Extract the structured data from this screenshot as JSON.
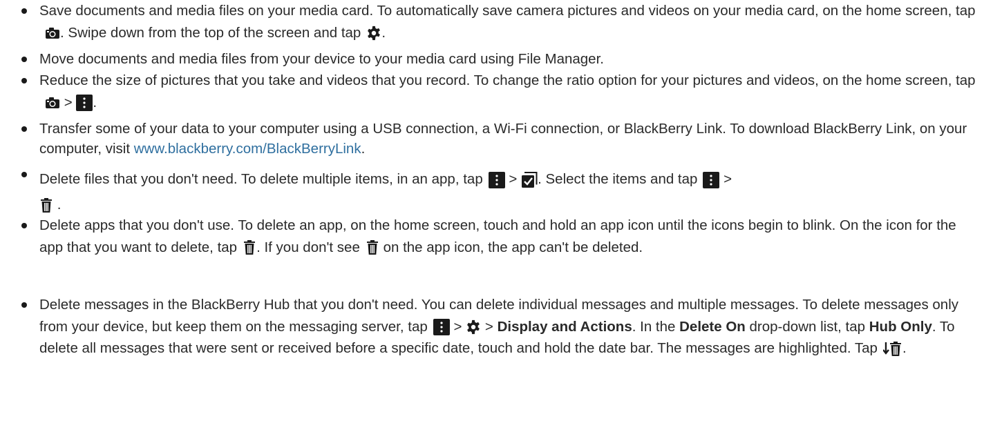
{
  "bullets": [
    {
      "p1": "Save documents and media files on your media card. To automatically save camera pictures and videos on your media card, on the home screen, tap",
      "p2": ". Swipe down from the top of the screen and tap",
      "p3": "."
    },
    {
      "p1": "Move documents and media files from your device to your media card using File Manager."
    },
    {
      "p1": "Reduce the size of pictures that you take and videos that you record. To change the ratio option for your pictures and videos, on the home screen, tap",
      "p2": ">",
      "p3": "."
    },
    {
      "p1": "Transfer some of your data to your computer using a USB connection, a Wi-Fi connection, or BlackBerry Link. To download BlackBerry Link, on your computer, visit",
      "link": "www.blackberry.com/BlackBerryLink",
      "p2": "."
    },
    {
      "p1": "Delete files that you don't need. To delete multiple items, in an app, tap",
      "p2": ">",
      "p3": ". Select the items and tap",
      "p4": ">",
      "p5": "."
    },
    {
      "p1": "Delete apps that you don't use. To delete an app, on the home screen, touch and hold an app icon until the icons begin to blink. On the icon for the app that you want to delete, tap",
      "p2": ". If you don't see",
      "p3": "on the app icon, the app can't be deleted."
    },
    {
      "p1": "Delete messages in the BlackBerry Hub that you don't need. You can delete individual messages and multiple messages. To delete messages only from your device, but keep them on the messaging server, tap",
      "p2": ">",
      "p3": ">",
      "b1": "Display and Actions",
      "p4": ". In the",
      "b2": "Delete On",
      "p5": "drop-down list, tap",
      "b3": "Hub Only",
      "p6": ". To delete all messages that were sent or received before a specific date, touch and hold the date bar. The messages are highlighted. Tap",
      "p7": "."
    }
  ],
  "icons": {
    "camera": "camera-icon",
    "settings": "gear-icon",
    "overflow": "overflow-menu-icon",
    "select": "select-items-icon",
    "delete": "trash-icon",
    "delete_prior": "delete-prior-icon"
  },
  "colors": {
    "link": "#2f6f9f",
    "text": "#2a2a2a",
    "icon_bg": "#1a1a1a"
  }
}
